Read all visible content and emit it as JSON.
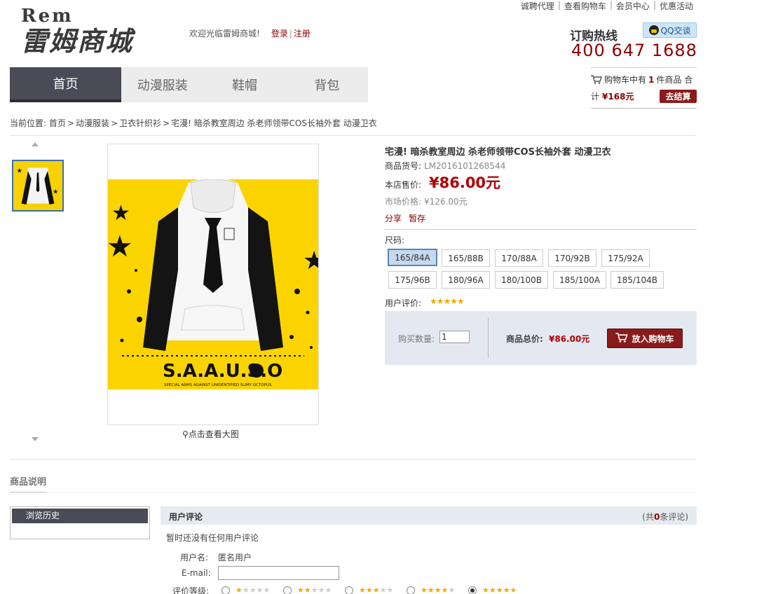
{
  "top_links": [
    "诚聘代理",
    "查看购物车",
    "会员中心",
    "优惠活动"
  ],
  "logo": {
    "en": "Rem",
    "cn": "雷姆商城"
  },
  "welcome": {
    "text": "欢迎光临雷姆商城!",
    "login": "登录",
    "sep": "|",
    "register": "注册"
  },
  "hotline": {
    "label": "订购热线",
    "qq": "QQ交谈",
    "phone": "400 647 1688"
  },
  "cart": {
    "prefix": "购物车中有",
    "count": "1",
    "suffix": "件商品 合",
    "line2_prefix": "计",
    "total": "¥168元",
    "checkout": "去结算"
  },
  "nav": [
    {
      "label": "首页",
      "active": true
    },
    {
      "label": "动漫服装",
      "active": false
    },
    {
      "label": "鞋帽",
      "active": false
    },
    {
      "label": "背包",
      "active": false
    }
  ],
  "breadcrumb": {
    "prefix": "当前位置:",
    "items": [
      "首页",
      "动漫服装",
      "卫衣针织衫",
      "宅漫! 暗杀教室周边 杀老师领带COS长袖外套 动漫卫衣"
    ],
    "sep": ">"
  },
  "gallery": {
    "zoom_text": "点击查看大图"
  },
  "product": {
    "title": "宅漫! 暗杀教室周边 杀老师领带COS长袖外套 动漫卫衣",
    "sku_label": "商品货号:",
    "sku": "LM2016101268544",
    "price_label": "本店售价:",
    "price": "¥86.00元",
    "market_label": "市场价格:",
    "market_price": "¥126.00元",
    "share": "分享",
    "save": "暂存",
    "size_label": "尺码:",
    "sizes": [
      "165/84A",
      "165/88B",
      "170/88A",
      "170/92B",
      "175/92A",
      "175/96B",
      "180/96A",
      "180/100B",
      "185/100A",
      "185/104B"
    ],
    "selected_size": "165/84A",
    "rating_label": "用户评价:",
    "rating": 5,
    "rating_stars": "★★★★★",
    "qty_label": "购买数量:",
    "qty": "1",
    "total_label": "商品总价:",
    "total": "¥86.00元",
    "add_to_cart": "放入购物车",
    "image_text": {
      "brand": "S.A.A.U.S.O",
      "tagline": "SPECIAL ARMS AGAINST UNIDENTIFIED SLIMY OCTOPUS"
    }
  },
  "desc_title": "商品说明",
  "history": {
    "title": "浏览历史"
  },
  "reviews": {
    "title": "用户评论",
    "count_prefix": "(共",
    "count": "0",
    "count_suffix": "条评论)",
    "empty": "暂时还没有任何用户评论",
    "user_label": "用户名:",
    "user_value": "匿名用户",
    "email_label": "E-mail:",
    "rank_label": "评价等级:",
    "rank_options": [
      1,
      2,
      3,
      4,
      5
    ],
    "rank_selected": 5
  },
  "colors": {
    "brand_red": "#8b1a1a",
    "price_red": "#b00000",
    "nav_active": "#4b4b57",
    "star": "#f2a900"
  }
}
